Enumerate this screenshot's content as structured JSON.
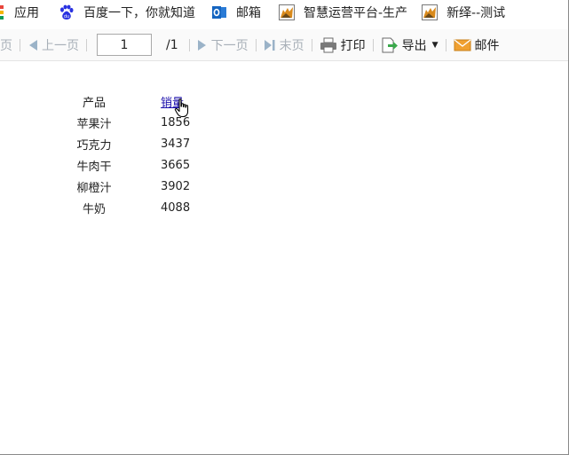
{
  "bookmarks": [
    {
      "label": "应用",
      "icon": "apps-grid-icon"
    },
    {
      "label": "百度一下，你就知道",
      "icon": "baidu-paw-icon"
    },
    {
      "label": "邮箱",
      "icon": "outlook-icon"
    },
    {
      "label": "智慧运营平台-生产",
      "icon": "fox-icon"
    },
    {
      "label": "新绎--测试",
      "icon": "fox-icon"
    }
  ],
  "toolbar": {
    "first_page": "首页",
    "prev_page": "上一页",
    "page_value": "1",
    "page_total": "/1",
    "next_page": "下一页",
    "last_page": "末页",
    "print": "打印",
    "export": "导出",
    "mail": "邮件"
  },
  "report": {
    "headers": [
      "产品",
      "销量"
    ],
    "rows": [
      [
        "苹果汁",
        "1856"
      ],
      [
        "巧克力",
        "3437"
      ],
      [
        "牛肉干",
        "3665"
      ],
      [
        "柳橙汁",
        "3902"
      ],
      [
        "牛奶",
        "4088"
      ]
    ]
  },
  "colors": {
    "disabled_text": "#a8b0b8",
    "link": "#1a0dab",
    "export_green": "#3aa84b",
    "mail_orange": "#f0a030"
  }
}
